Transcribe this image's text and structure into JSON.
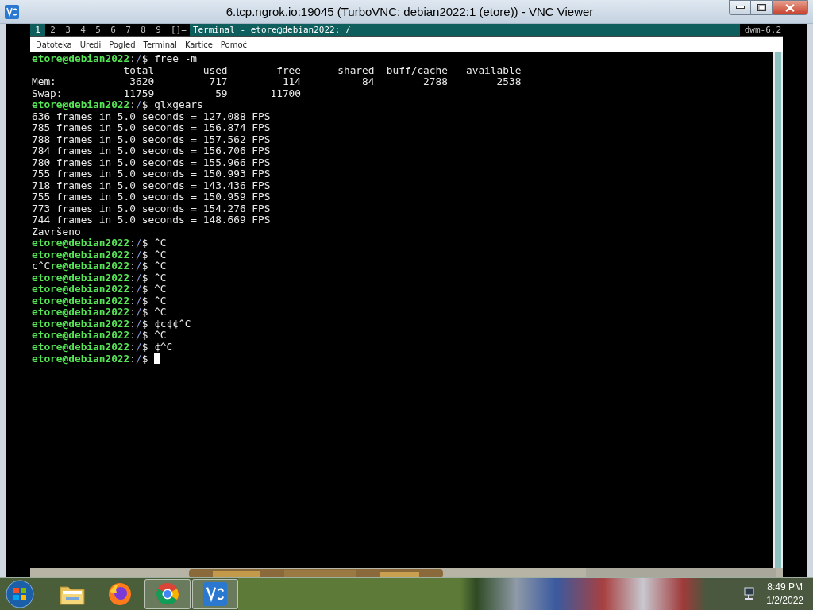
{
  "window": {
    "title": "6.tcp.ngrok.io:19045 (TurboVNC: debian2022:1 (etore)) - VNC Viewer"
  },
  "dwm_bar": {
    "tags": [
      {
        "label": "1",
        "selected": true
      },
      {
        "label": "2",
        "selected": false
      },
      {
        "label": "3",
        "selected": false
      },
      {
        "label": "4",
        "selected": false
      },
      {
        "label": "5",
        "selected": false
      },
      {
        "label": "6",
        "selected": false
      },
      {
        "label": "7",
        "selected": false
      },
      {
        "label": "8",
        "selected": false
      },
      {
        "label": "9",
        "selected": false
      }
    ],
    "layout": "[]=",
    "window_title": "Terminal - etore@debian2022: /",
    "status": "dwm-6.2"
  },
  "terminal": {
    "menu": [
      "Datoteka",
      "Uredi",
      "Pogled",
      "Terminal",
      "Kartice",
      "Pomoć"
    ],
    "lines": [
      {
        "segments": [
          {
            "kind": "user",
            "text": "etore@debian2022"
          },
          {
            "kind": "plain",
            "text": ":"
          },
          {
            "kind": "path",
            "text": "/"
          },
          {
            "kind": "plain",
            "text": "$ free -m"
          }
        ],
        "cursor": false
      },
      {
        "segments": [
          {
            "kind": "plain",
            "text": "               total        used        free      shared  buff/cache   available"
          }
        ],
        "cursor": false
      },
      {
        "segments": [
          {
            "kind": "plain",
            "text": "Mem:            3620         717         114          84        2788        2538"
          }
        ],
        "cursor": false
      },
      {
        "segments": [
          {
            "kind": "plain",
            "text": "Swap:          11759          59       11700"
          }
        ],
        "cursor": false
      },
      {
        "segments": [
          {
            "kind": "user",
            "text": "etore@debian2022"
          },
          {
            "kind": "plain",
            "text": ":"
          },
          {
            "kind": "path",
            "text": "/"
          },
          {
            "kind": "plain",
            "text": "$ glxgears"
          }
        ],
        "cursor": false
      },
      {
        "segments": [
          {
            "kind": "plain",
            "text": "636 frames in 5.0 seconds = 127.088 FPS"
          }
        ],
        "cursor": false
      },
      {
        "segments": [
          {
            "kind": "plain",
            "text": "785 frames in 5.0 seconds = 156.874 FPS"
          }
        ],
        "cursor": false
      },
      {
        "segments": [
          {
            "kind": "plain",
            "text": "788 frames in 5.0 seconds = 157.562 FPS"
          }
        ],
        "cursor": false
      },
      {
        "segments": [
          {
            "kind": "plain",
            "text": "784 frames in 5.0 seconds = 156.706 FPS"
          }
        ],
        "cursor": false
      },
      {
        "segments": [
          {
            "kind": "plain",
            "text": "780 frames in 5.0 seconds = 155.966 FPS"
          }
        ],
        "cursor": false
      },
      {
        "segments": [
          {
            "kind": "plain",
            "text": "755 frames in 5.0 seconds = 150.993 FPS"
          }
        ],
        "cursor": false
      },
      {
        "segments": [
          {
            "kind": "plain",
            "text": "718 frames in 5.0 seconds = 143.436 FPS"
          }
        ],
        "cursor": false
      },
      {
        "segments": [
          {
            "kind": "plain",
            "text": "755 frames in 5.0 seconds = 150.959 FPS"
          }
        ],
        "cursor": false
      },
      {
        "segments": [
          {
            "kind": "plain",
            "text": "773 frames in 5.0 seconds = 154.276 FPS"
          }
        ],
        "cursor": false
      },
      {
        "segments": [
          {
            "kind": "plain",
            "text": "744 frames in 5.0 seconds = 148.669 FPS"
          }
        ],
        "cursor": false
      },
      {
        "segments": [
          {
            "kind": "plain",
            "text": "Završeno"
          }
        ],
        "cursor": false
      },
      {
        "segments": [
          {
            "kind": "user",
            "text": "etore@debian2022"
          },
          {
            "kind": "plain",
            "text": ":"
          },
          {
            "kind": "path",
            "text": "/"
          },
          {
            "kind": "plain",
            "text": "$ ^C"
          }
        ],
        "cursor": false
      },
      {
        "segments": [
          {
            "kind": "user",
            "text": "etore@debian2022"
          },
          {
            "kind": "plain",
            "text": ":"
          },
          {
            "kind": "path",
            "text": "/"
          },
          {
            "kind": "plain",
            "text": "$ ^C"
          }
        ],
        "cursor": false
      },
      {
        "segments": [
          {
            "kind": "plain",
            "text": "c^C"
          },
          {
            "kind": "user",
            "text": "re@debian2022"
          },
          {
            "kind": "plain",
            "text": ":"
          },
          {
            "kind": "path",
            "text": "/"
          },
          {
            "kind": "plain",
            "text": "$ ^C"
          }
        ],
        "cursor": false
      },
      {
        "segments": [
          {
            "kind": "user",
            "text": "etore@debian2022"
          },
          {
            "kind": "plain",
            "text": ":"
          },
          {
            "kind": "path",
            "text": "/"
          },
          {
            "kind": "plain",
            "text": "$ ^C"
          }
        ],
        "cursor": false
      },
      {
        "segments": [
          {
            "kind": "user",
            "text": "etore@debian2022"
          },
          {
            "kind": "plain",
            "text": ":"
          },
          {
            "kind": "path",
            "text": "/"
          },
          {
            "kind": "plain",
            "text": "$ ^C"
          }
        ],
        "cursor": false
      },
      {
        "segments": [
          {
            "kind": "user",
            "text": "etore@debian2022"
          },
          {
            "kind": "plain",
            "text": ":"
          },
          {
            "kind": "path",
            "text": "/"
          },
          {
            "kind": "plain",
            "text": "$ ^C"
          }
        ],
        "cursor": false
      },
      {
        "segments": [
          {
            "kind": "user",
            "text": "etore@debian2022"
          },
          {
            "kind": "plain",
            "text": ":"
          },
          {
            "kind": "path",
            "text": "/"
          },
          {
            "kind": "plain",
            "text": "$ ^C"
          }
        ],
        "cursor": false
      },
      {
        "segments": [
          {
            "kind": "user",
            "text": "etore@debian2022"
          },
          {
            "kind": "plain",
            "text": ":"
          },
          {
            "kind": "path",
            "text": "/"
          },
          {
            "kind": "plain",
            "text": "$ ¢¢¢¢^C"
          }
        ],
        "cursor": false
      },
      {
        "segments": [
          {
            "kind": "user",
            "text": "etore@debian2022"
          },
          {
            "kind": "plain",
            "text": ":"
          },
          {
            "kind": "path",
            "text": "/"
          },
          {
            "kind": "plain",
            "text": "$ ^C"
          }
        ],
        "cursor": false
      },
      {
        "segments": [
          {
            "kind": "user",
            "text": "etore@debian2022"
          },
          {
            "kind": "plain",
            "text": ":"
          },
          {
            "kind": "path",
            "text": "/"
          },
          {
            "kind": "plain",
            "text": "$ ¢^C"
          }
        ],
        "cursor": false
      },
      {
        "segments": [
          {
            "kind": "user",
            "text": "etore@debian2022"
          },
          {
            "kind": "plain",
            "text": ":"
          },
          {
            "kind": "path",
            "text": "/"
          },
          {
            "kind": "plain",
            "text": "$ "
          }
        ],
        "cursor": true
      }
    ]
  },
  "taskbar": {
    "apps": [
      {
        "kind": "folder",
        "running": false
      },
      {
        "kind": "firefox",
        "running": false
      },
      {
        "kind": "chrome",
        "running": true
      },
      {
        "kind": "vnc",
        "running": true
      }
    ],
    "time": "8:49 PM",
    "date": "1/2/2022"
  }
}
